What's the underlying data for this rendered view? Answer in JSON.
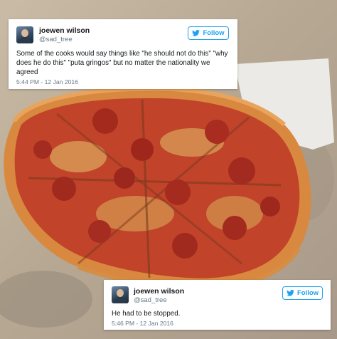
{
  "tweets": [
    {
      "display_name": "joewen wilson",
      "handle": "@sad_tree",
      "follow_label": "Follow",
      "text": "Some of the cooks would say things like \"he should not do this\" \"why does he do this\" \"puta gringos\" but no matter the nationality we agreed",
      "timestamp": "5:44 PM - 12 Jan 2016"
    },
    {
      "display_name": "joewen wilson",
      "handle": "@sad_tree",
      "follow_label": "Follow",
      "text": "He had to be stopped.",
      "timestamp": "5:46 PM - 12 Jan 2016"
    }
  ],
  "colors": {
    "twitter_blue": "#1da1f2",
    "muted_text": "#657786",
    "cardboard": "#b9ab97"
  },
  "icons": [
    "twitter-bird-icon",
    "avatar-image"
  ]
}
